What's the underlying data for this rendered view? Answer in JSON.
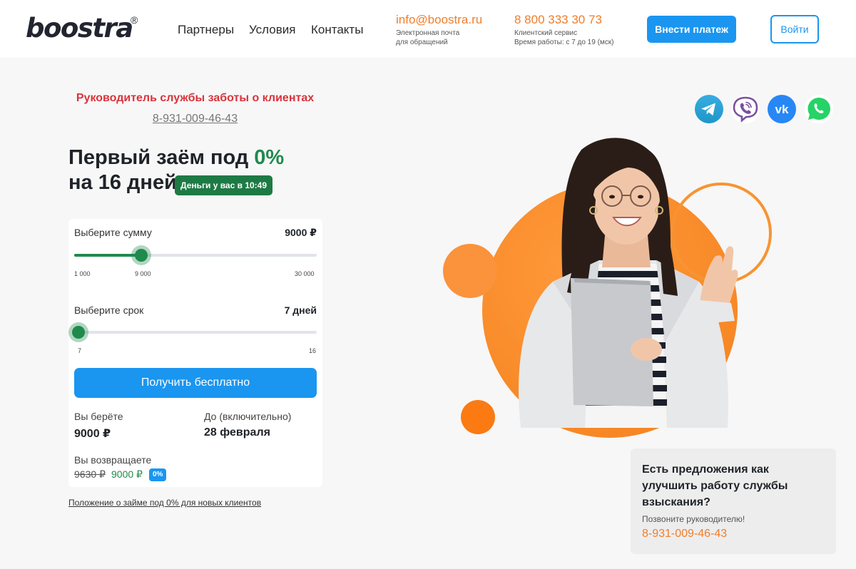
{
  "header": {
    "logo": "boostra",
    "logo_mark": "®",
    "nav": [
      "Партнеры",
      "Условия",
      "Контакты"
    ],
    "email": "info@boostra.ru",
    "email_caption_1": "Электронная почта",
    "email_caption_2": "для обращений",
    "phone": "8 800 333 30 73",
    "phone_caption_1": "Клиентский сервис",
    "phone_caption_2": "Время работы: с 7 до 19 (мск)",
    "pay_button": "Внести платеж",
    "login_button": "Войти"
  },
  "manager": {
    "title": "Руководитель службы заботы о клиентах",
    "phone": "8-931-009-46-43"
  },
  "promo": {
    "line1_prefix": "Первый заём под ",
    "line1_accent": "0%",
    "line2": "на 16 дней",
    "badge": "Деньги у вас в 10:49"
  },
  "calculator": {
    "amount": {
      "label": "Выберите сумму",
      "value_text": "9000 ₽",
      "min": 1000,
      "max": 30000,
      "value": 9000,
      "ticks": [
        "1 000",
        "9 000",
        "30 000"
      ]
    },
    "term": {
      "label": "Выберите срок",
      "value_text": "7 дней",
      "min": 7,
      "max": 16,
      "value": 7,
      "ticks": [
        "7",
        "16"
      ]
    },
    "submit": "Получить бесплатно",
    "take_label": "Вы берёте",
    "take_value": "9000 ₽",
    "until_label": "До (включительно)",
    "until_value": "28 февраля",
    "return_label": "Вы возвращаете",
    "return_old": "9630 ₽",
    "return_new": "9000 ₽",
    "return_badge": "0%"
  },
  "terms_link": "Положение о займе под 0% для новых клиентов",
  "socials": [
    "telegram-icon",
    "viber-icon",
    "vk-icon",
    "whatsapp-icon"
  ],
  "feedback": {
    "title": "Есть предложения как улучшить работу службы взыскания?",
    "subtitle": "Позвоните руководителю!",
    "phone": "8-931-009-46-43"
  },
  "colors": {
    "accent_blue": "#1a96f0",
    "accent_green": "#1f8a4c",
    "accent_orange": "#f07e2b",
    "manager_red": "#d9343c"
  }
}
